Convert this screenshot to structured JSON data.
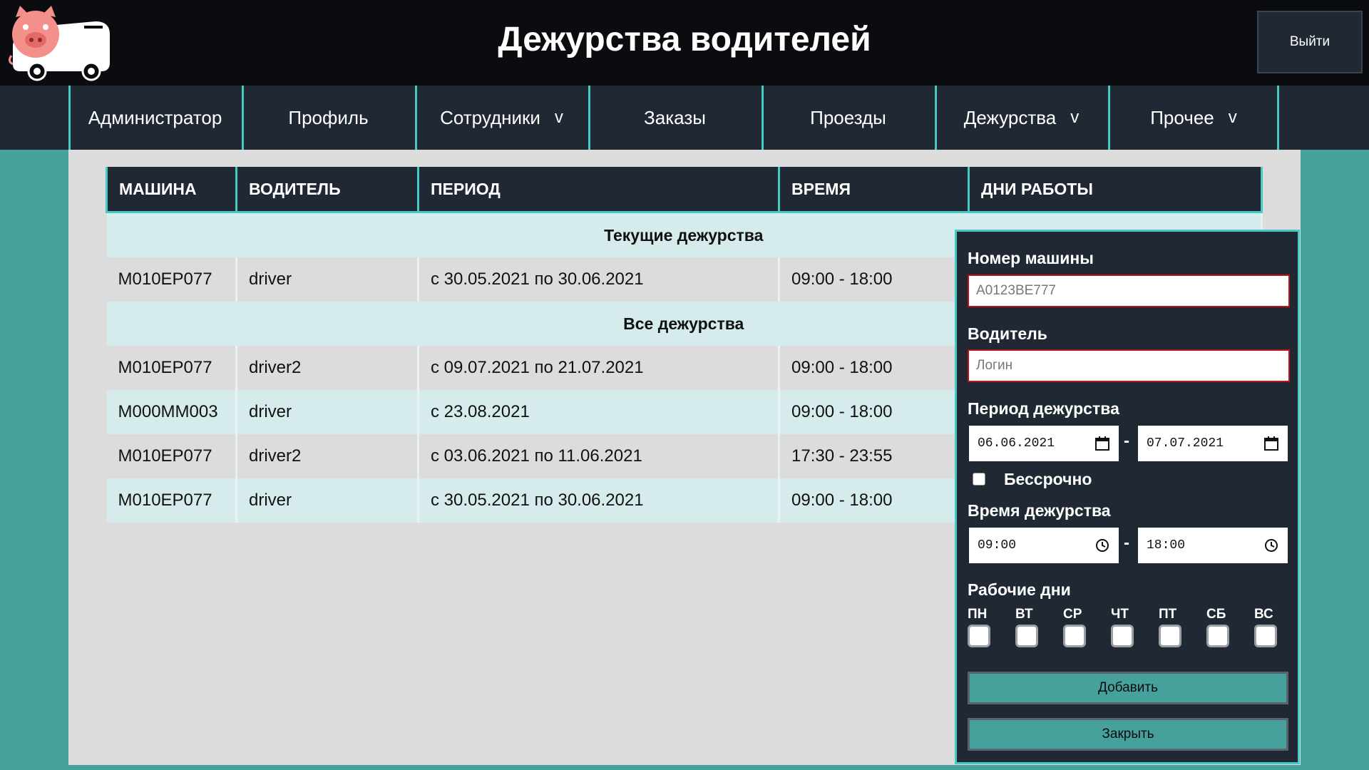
{
  "header": {
    "title": "Дежурства водителей",
    "logout_label": "Выйти"
  },
  "nav": {
    "items": [
      {
        "label": "Администратор"
      },
      {
        "label": "Профиль"
      },
      {
        "label": "Сотрудники",
        "chevron": "v"
      },
      {
        "label": "Заказы"
      },
      {
        "label": "Проезды"
      },
      {
        "label": "Дежурства",
        "chevron": "v"
      },
      {
        "label": "Прочее",
        "chevron": "v"
      }
    ]
  },
  "table": {
    "headers": [
      "МАШИНА",
      "ВОДИТЕЛЬ",
      "ПЕРИОД",
      "ВРЕМЯ",
      "ДНИ РАБОТЫ"
    ],
    "current_section": "Текущие дежурства",
    "current_rows": [
      {
        "car": "M010EP077",
        "driver": "driver",
        "period": "с 30.05.2021 по 30.06.2021",
        "time": "09:00 - 18:00"
      }
    ],
    "all_section": "Все дежурства",
    "all_rows": [
      {
        "car": "M010EP077",
        "driver": "driver2",
        "period": "с 09.07.2021 по 21.07.2021",
        "time": "09:00 - 18:00"
      },
      {
        "car": "M000MM003",
        "driver": "driver",
        "period": "с 23.08.2021",
        "time": "09:00 - 18:00"
      },
      {
        "car": "M010EP077",
        "driver": "driver2",
        "period": "с 03.06.2021 по 11.06.2021",
        "time": "17:30 - 23:55"
      },
      {
        "car": "M010EP077",
        "driver": "driver",
        "period": "с 30.05.2021 по 30.06.2021",
        "time": "09:00 - 18:00"
      }
    ]
  },
  "form": {
    "car_label": "Номер машины",
    "car_placeholder": "A0123BE777",
    "driver_label": "Водитель",
    "driver_placeholder": "Логин",
    "period_label": "Период дежурства",
    "date_from": "06.06.2021",
    "date_to": "07.07.2021",
    "dash": "-",
    "indefinite_label": "Бессрочно",
    "indefinite_checked": false,
    "time_label": "Время дежурства",
    "time_from": "09:00",
    "time_to": "18:00",
    "workdays_label": "Рабочие дни",
    "days": [
      "ПН",
      "ВТ",
      "СР",
      "ЧТ",
      "ПТ",
      "СБ",
      "ВС"
    ],
    "add_label": "Добавить",
    "close_label": "Закрыть"
  },
  "colors": {
    "accent": "#45c9c4",
    "bg_teal": "#46a19c",
    "dark": "#1f2833",
    "header_bg": "#0b0c10",
    "error_border": "#c0121c"
  }
}
